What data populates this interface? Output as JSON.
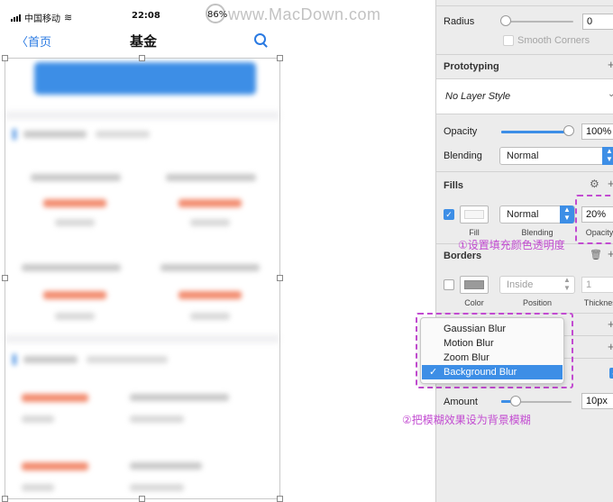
{
  "status_bar": {
    "carrier": "中国移动",
    "time": "22:08",
    "battery": "86%"
  },
  "watermark": "www.MacDown.com",
  "nav": {
    "back_label": "首页",
    "title": "基金"
  },
  "inspector": {
    "radius": {
      "label": "Radius",
      "value": "0",
      "smooth_corners_label": "Smooth Corners"
    },
    "prototyping": {
      "title": "Prototyping"
    },
    "layer_style": {
      "value": "No Layer Style"
    },
    "opacity": {
      "label": "Opacity",
      "value": "100%"
    },
    "blending": {
      "label": "Blending",
      "value": "Normal"
    },
    "fills": {
      "title": "Fills",
      "blend_value": "Normal",
      "opacity_value": "20%",
      "fill_caption": "Fill",
      "blending_caption": "Blending",
      "opacity_caption": "Opacity"
    },
    "borders": {
      "title": "Borders",
      "position_value": "Inside",
      "thickness_value": "1",
      "color_caption": "Color",
      "position_caption": "Position",
      "thickness_caption": "Thickness"
    },
    "amount": {
      "label": "Amount",
      "value": "10px",
      "level": 0.2
    }
  },
  "blur_menu": {
    "items": [
      "Gaussian Blur",
      "Motion Blur",
      "Zoom Blur",
      "Background Blur"
    ],
    "selected_index": 3
  },
  "annotations": {
    "first": "①设置填充颜色透明度",
    "second": "②把模糊效果设为背景模糊"
  },
  "colors": {
    "accent": "#3d8ee6",
    "annotation": "#c24bd1",
    "fill_red": "#f28b6e"
  }
}
